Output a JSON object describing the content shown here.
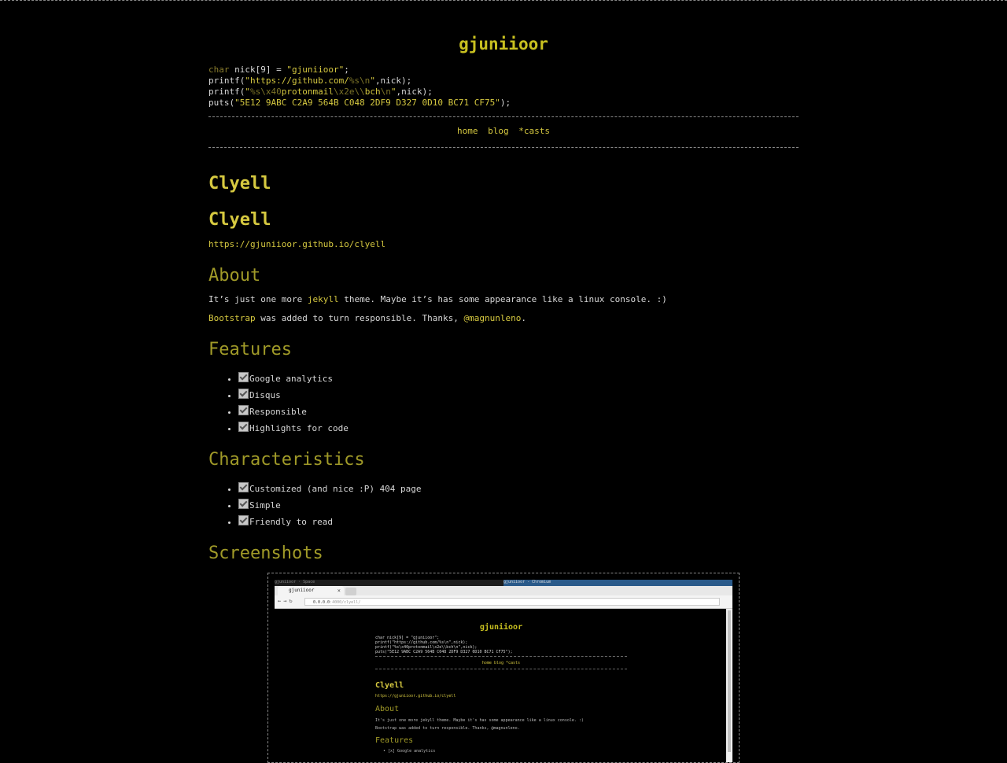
{
  "header": {
    "title": "gjuniioor",
    "code": {
      "line1": {
        "kw": "char",
        "rest": " nick[9] = ",
        "str": "\"gjuniioor\"",
        "end": ";"
      },
      "line2": {
        "pre": "printf(",
        "str1": "\"https://github.com/",
        "esc1": "%s\\n",
        "str2": "\"",
        "end": ",nick);"
      },
      "line3": {
        "pre": "printf(",
        "str1": "\"",
        "esc1": "%s\\x40",
        "str2": "protonmail",
        "esc2": "\\x2e\\\\",
        "str3": "bch",
        "esc3": "\\n",
        "str4": "\"",
        "end": ",nick);"
      },
      "line4": {
        "pre": "puts(",
        "str": "\"5E12 9ABC C2A9 564B C048 2DF9 D327 0D10 BC71 CF75\"",
        "end": ");"
      }
    }
  },
  "nav": {
    "items": [
      "home",
      "blog",
      "*casts"
    ]
  },
  "content": {
    "page_title": "Clyell",
    "heading": "Clyell",
    "repo_link": "https://gjuniioor.github.io/clyell",
    "about": {
      "title": "About",
      "p1_pre": "It’s just one more ",
      "p1_link": "jekyll",
      "p1_post": " theme. Maybe it’s has some appearance like a linux console. :)",
      "p2_link": "Bootstrap",
      "p2_mid": " was added to turn responsible. Thanks, ",
      "p2_link2": "@magnunleno",
      "p2_end": "."
    },
    "features": {
      "title": "Features",
      "items": [
        "Google analytics",
        "Disqus",
        "Responsible",
        "Highlights for code"
      ]
    },
    "characteristics": {
      "title": "Characteristics",
      "items": [
        "Customized (and nice :P) 404 page",
        "Simple",
        "Friendly to read"
      ]
    },
    "screenshots": {
      "title": "Screenshots"
    }
  },
  "screenshot_image": {
    "os_left": "gjuniioor · Space",
    "os_right": "gjuniioor - Chromium",
    "tab_label": "gjuniioor",
    "url_host": "0.0.0.0",
    "url_path": ":4000/clyell/",
    "mini_title": "gjuniioor",
    "mini_code": "char nick[9] = \"gjuniioor\";\nprintf(\"https://github.com/%s\\n\",nick);\nprintf(\"%s\\x40protonmail\\x2e\\\\bch\\n\",nick);\nputs(\"5E12 9ABC C2A9 564B C048 2DF9 D327 0D10 BC71 CF75\");",
    "mini_nav": "home  blog  *casts",
    "mini_h1": "Clyell",
    "mini_link": "https://gjuniioor.github.io/clyell",
    "mini_about": "About",
    "mini_p1": "It's just one more jekyll theme. Maybe it's has some appearance like a linux console. :)",
    "mini_p2": "Bootstrap was added to turn responsible. Thanks, @magnunleno.",
    "mini_features": "Features",
    "mini_li1": "• [x] Google analytics"
  },
  "colors": {
    "background": "#000000",
    "accent": "#d6c940",
    "heading_dim": "#a09a28",
    "text": "#d7d7d7"
  }
}
